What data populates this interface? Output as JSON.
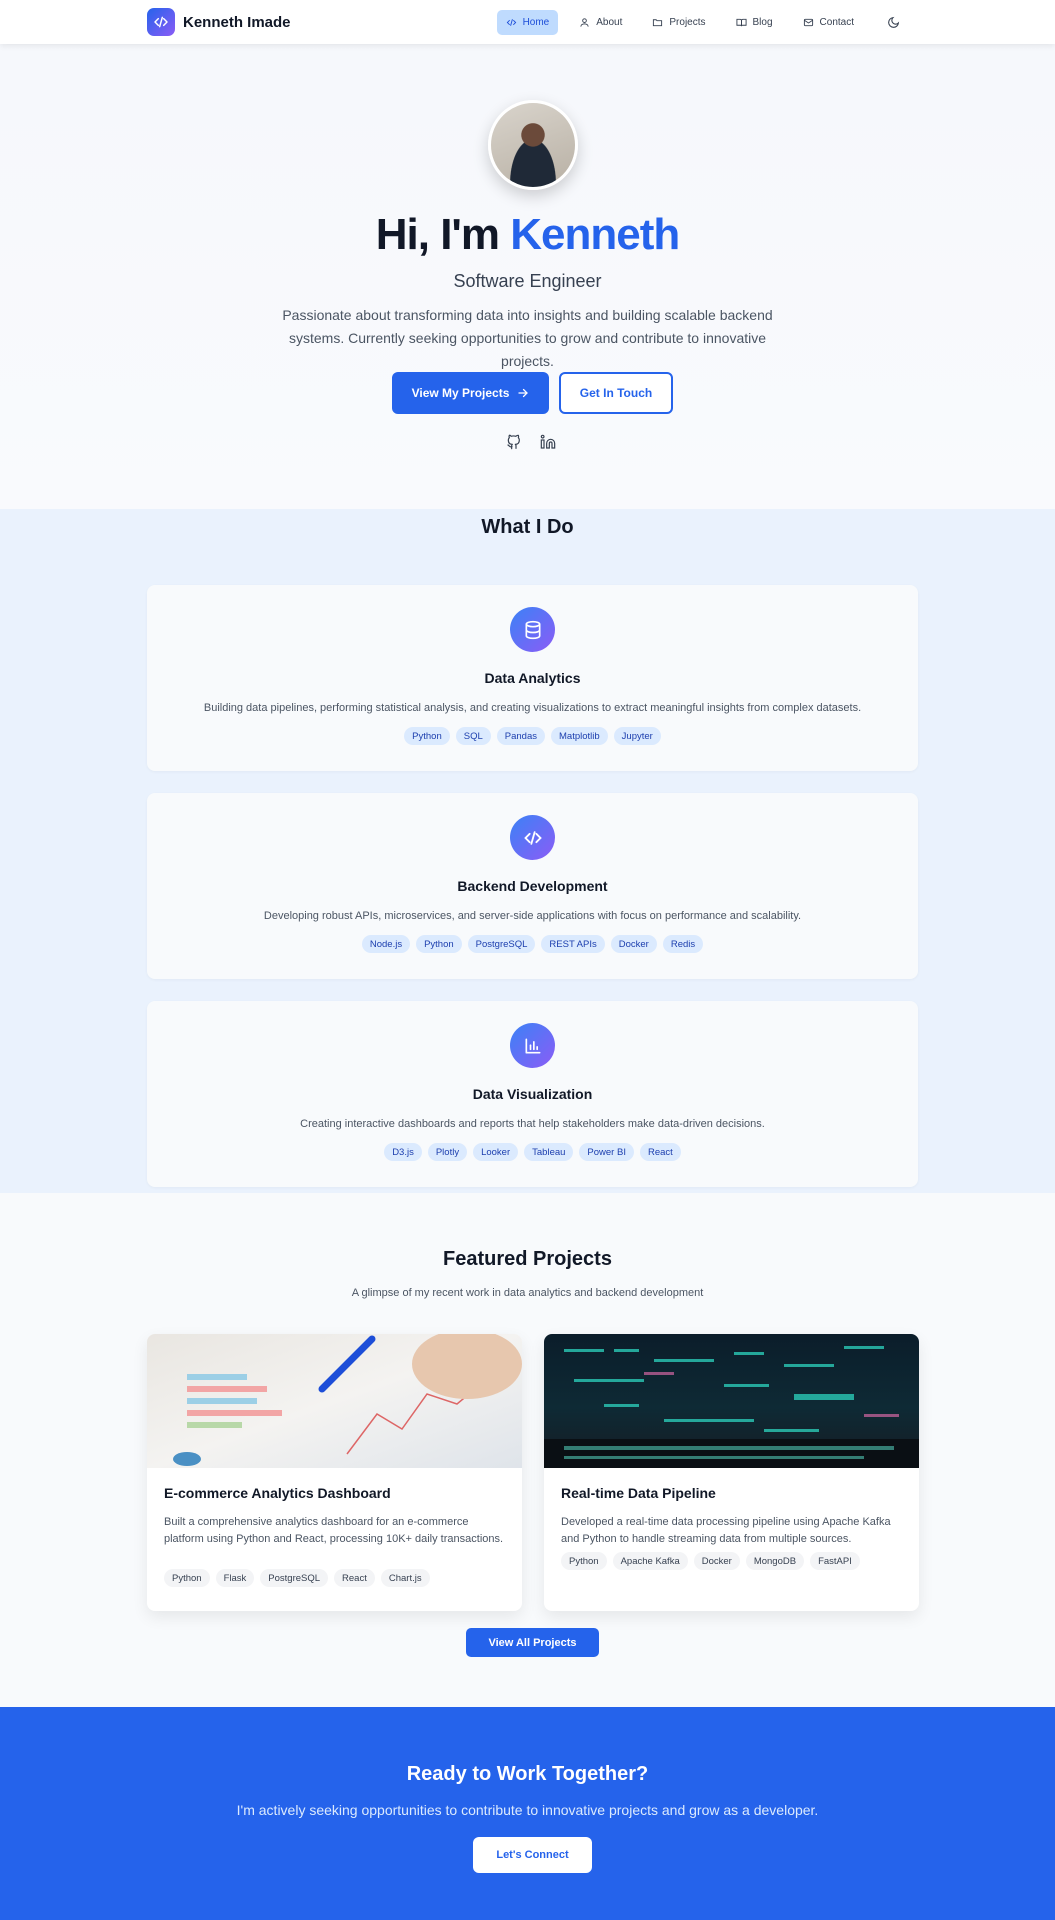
{
  "nav": {
    "brand": "Kenneth Imade",
    "items": [
      {
        "label": "Home",
        "icon": "code-icon",
        "active": true
      },
      {
        "label": "About",
        "icon": "user-icon"
      },
      {
        "label": "Projects",
        "icon": "folder-icon"
      },
      {
        "label": "Blog",
        "icon": "book-icon"
      },
      {
        "label": "Contact",
        "icon": "mail-icon"
      }
    ],
    "theme_icon": "moon-icon"
  },
  "hero": {
    "greeting": "Hi, I'm ",
    "name": "Kenneth",
    "role": "Software Engineer",
    "bio": "Passionate about transforming data into insights and building scalable backend systems. Currently seeking opportunities to grow and contribute to innovative projects.",
    "primary_button": "View My Projects",
    "secondary_button": "Get In Touch",
    "socials": [
      "github-icon",
      "linkedin-icon"
    ]
  },
  "services": {
    "title": "What I Do",
    "cards": [
      {
        "icon": "database-icon",
        "title": "Data Analytics",
        "description": "Building data pipelines, performing statistical analysis, and creating visualizations to extract meaningful insights from complex datasets.",
        "tags": [
          "Python",
          "SQL",
          "Pandas",
          "Matplotlib",
          "Jupyter"
        ]
      },
      {
        "icon": "code-icon",
        "title": "Backend Development",
        "description": "Developing robust APIs, microservices, and server-side applications with focus on performance and scalability.",
        "tags": [
          "Node.js",
          "Python",
          "PostgreSQL",
          "REST APIs",
          "Docker",
          "Redis"
        ]
      },
      {
        "icon": "bar-chart-icon",
        "title": "Data Visualization",
        "description": "Creating interactive dashboards and reports that help stakeholders make data-driven decisions.",
        "tags": [
          "D3.js",
          "Plotly",
          "Looker",
          "Tableau",
          "Power BI",
          "React"
        ]
      }
    ]
  },
  "projects": {
    "title": "Featured Projects",
    "subtitle": "A glimpse of my recent work in data analytics and backend development",
    "items": [
      {
        "title": "E-commerce Analytics Dashboard",
        "description": "Built a comprehensive analytics dashboard for an e-commerce platform using Python and React, processing 10K+ daily transactions.",
        "tags": [
          "Python",
          "Flask",
          "PostgreSQL",
          "React",
          "Chart.js"
        ]
      },
      {
        "title": "Real-time Data Pipeline",
        "description": "Developed a real-time data processing pipeline using Apache Kafka and Python to handle streaming data from multiple sources.",
        "tags": [
          "Python",
          "Apache Kafka",
          "Docker",
          "MongoDB",
          "FastAPI"
        ]
      }
    ],
    "view_all": "View All Projects"
  },
  "cta": {
    "title": "Ready to Work Together?",
    "text": "I'm actively seeking opportunities to contribute to innovative projects and grow as a developer.",
    "button": "Let's Connect"
  },
  "colors": {
    "accent": "#2563eb",
    "tag_bg": "#dbeafe",
    "tag_text": "#1e40af"
  }
}
